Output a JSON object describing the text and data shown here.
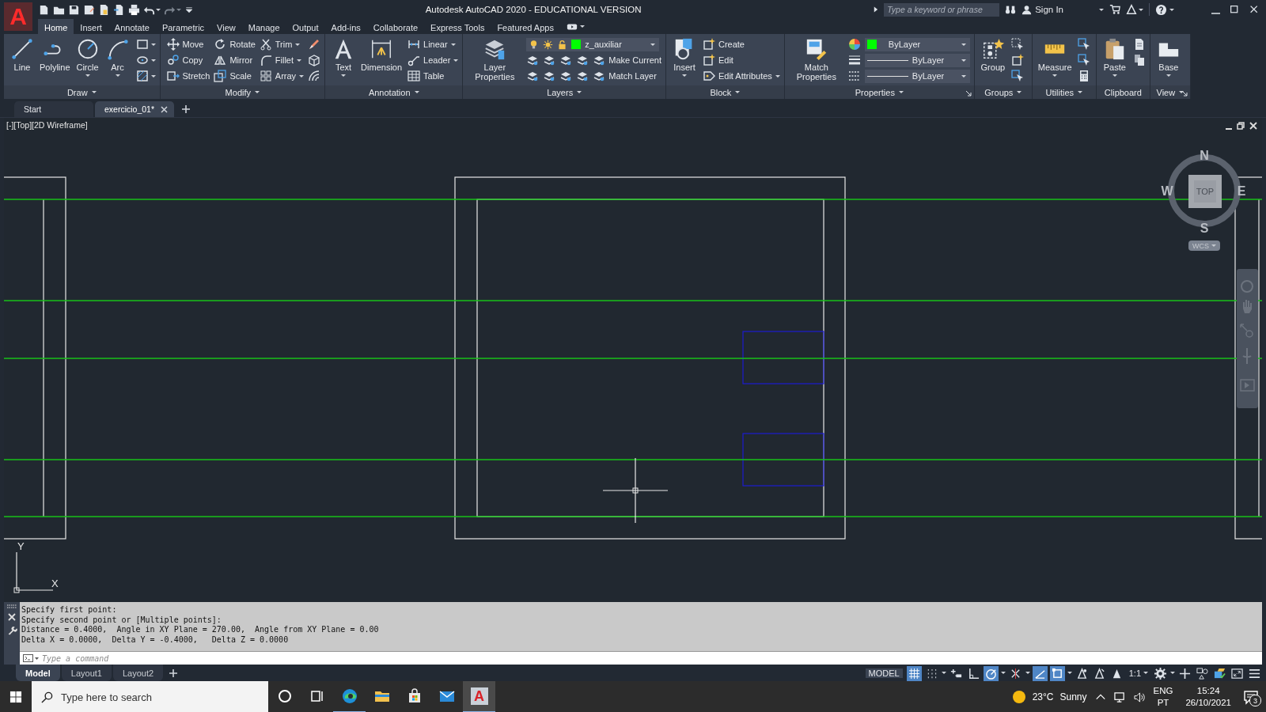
{
  "title_bar": {
    "logo": "A",
    "title": "Autodesk AutoCAD 2020 - EDUCATIONAL VERSION",
    "search": {
      "placeholder": "Type a keyword or phrase"
    },
    "sign_in": "Sign In"
  },
  "menu_tabs": [
    {
      "label": "Home",
      "selected": true
    },
    {
      "label": "Insert",
      "selected": false
    },
    {
      "label": "Annotate",
      "selected": false
    },
    {
      "label": "Parametric",
      "selected": false
    },
    {
      "label": "View",
      "selected": false
    },
    {
      "label": "Manage",
      "selected": false
    },
    {
      "label": "Output",
      "selected": false
    },
    {
      "label": "Add-ins",
      "selected": false
    },
    {
      "label": "Collaborate",
      "selected": false
    },
    {
      "label": "Express Tools",
      "selected": false
    },
    {
      "label": "Featured Apps",
      "selected": false
    }
  ],
  "ribbon": {
    "panels": [
      {
        "title": "Draw",
        "menu": true,
        "launcher": false,
        "large": [
          {
            "label": "Line",
            "kind": "plain"
          },
          {
            "label": "Polyline",
            "kind": "plain"
          },
          {
            "label": "Circle",
            "kind": "menu"
          },
          {
            "label": "Arc",
            "kind": "menu"
          }
        ],
        "items": [
          {
            "kind": "icon_menu"
          },
          {
            "kind": "icon_menu"
          },
          {
            "kind": "icon_menu"
          }
        ]
      },
      {
        "title": "Modify",
        "menu": true,
        "launcher": false,
        "items": [
          {
            "kind": "small",
            "label": "Move"
          },
          {
            "kind": "small",
            "label": "Rotate"
          },
          {
            "kind": "small_menu",
            "label": "Trim"
          },
          {
            "kind": "icon"
          },
          {
            "kind": "small",
            "label": "Copy"
          },
          {
            "kind": "small",
            "label": "Mirror"
          },
          {
            "kind": "small_menu",
            "label": "Fillet"
          },
          {
            "kind": "icon"
          },
          {
            "kind": "small",
            "label": "Stretch"
          },
          {
            "kind": "small",
            "label": "Scale"
          },
          {
            "kind": "small_menu",
            "label": "Array"
          },
          {
            "kind": "icon"
          }
        ]
      },
      {
        "title": "Annotation",
        "menu": true,
        "launcher": false,
        "large": [
          {
            "label": "Text",
            "kind": "menu"
          },
          {
            "label": "Dimension",
            "kind": "plain"
          }
        ],
        "items": [
          {
            "kind": "small_menu",
            "label": "Linear"
          },
          {
            "kind": "small_menu",
            "label": "Leader"
          },
          {
            "kind": "small",
            "label": "Table"
          }
        ]
      },
      {
        "title": "Layers",
        "menu": true,
        "launcher": false,
        "large": [
          {
            "label": "Layer Properties",
            "kind": "plain"
          }
        ],
        "items": [
          {
            "kind": "layer_select",
            "value": "z_auxiliar",
            "color": "#00ff00"
          },
          {
            "kind": "icon"
          },
          {
            "kind": "icon"
          },
          {
            "kind": "icon"
          },
          {
            "kind": "icon"
          },
          {
            "kind": "small",
            "label": "Make Current"
          },
          {
            "kind": "icon"
          },
          {
            "kind": "icon"
          },
          {
            "kind": "icon"
          },
          {
            "kind": "icon"
          },
          {
            "kind": "small",
            "label": "Match Layer"
          }
        ]
      },
      {
        "title": "Block",
        "menu": true,
        "launcher": false,
        "large": [
          {
            "label": "Insert",
            "kind": "menu"
          }
        ],
        "items": [
          {
            "kind": "small",
            "label": "Create"
          },
          {
            "kind": "small",
            "label": "Edit"
          },
          {
            "kind": "small_menu",
            "label": "Edit Attributes"
          }
        ]
      },
      {
        "title": "Properties",
        "menu": true,
        "launcher": true,
        "large": [
          {
            "label": "Match Properties",
            "kind": "plain"
          }
        ],
        "items": [
          {
            "kind": "icon"
          },
          {
            "kind": "color_select",
            "value": "ByLayer",
            "color": "#00ff00"
          },
          {
            "kind": "icon"
          },
          {
            "kind": "line_select",
            "value": "ByLayer"
          },
          {
            "kind": "icon"
          },
          {
            "kind": "line_select",
            "value": "ByLayer"
          }
        ]
      },
      {
        "title": "Groups",
        "menu": true,
        "launcher": false,
        "large": [
          {
            "label": "Group",
            "kind": "plain"
          }
        ],
        "items": [
          {
            "kind": "icon"
          },
          {
            "kind": "icon"
          },
          {
            "kind": "icon"
          }
        ]
      },
      {
        "title": "Utilities",
        "menu": true,
        "launcher": false,
        "large": [
          {
            "label": "Measure",
            "kind": "menu"
          }
        ],
        "items": [
          {
            "kind": "icon"
          },
          {
            "kind": "icon"
          },
          {
            "kind": "icon"
          }
        ]
      },
      {
        "title": "Clipboard",
        "menu": false,
        "launcher": false,
        "large": [
          {
            "label": "Paste",
            "kind": "menu"
          }
        ],
        "items": [
          {
            "kind": "icon"
          },
          {
            "kind": "icon"
          }
        ]
      },
      {
        "title": "View",
        "menu": true,
        "launcher": true,
        "large": [
          {
            "label": "Base",
            "kind": "menu"
          }
        ]
      }
    ]
  },
  "file_tabs": [
    {
      "label": "Start",
      "selected": false,
      "closable": false
    },
    {
      "label": "exercicio_01*",
      "selected": true,
      "closable": true
    }
  ],
  "viewport": {
    "label": "[-][Top][2D Wireframe]",
    "viewcube": {
      "north": "N",
      "south": "S",
      "west": "W",
      "east": "E",
      "face": "TOP"
    },
    "ucs_menu": "WCS",
    "ucs_icon": {
      "x": "X",
      "y": "Y"
    }
  },
  "command": {
    "history": [
      "Specify first point:",
      "Specify second point or [Multiple points]:",
      "Distance = 0.4000,  Angle in XY Plane = 270.00,  Angle from XY Plane = 0.00",
      "Delta X = 0.0000,  Delta Y = -0.4000,   Delta Z = 0.0000"
    ],
    "placeholder": "Type a command"
  },
  "layout_tabs": [
    {
      "label": "Model",
      "selected": true
    },
    {
      "label": "Layout1",
      "selected": false
    },
    {
      "label": "Layout2",
      "selected": false
    }
  ],
  "status_bar": {
    "model": "MODEL",
    "toggles": [
      {
        "on": true
      },
      {
        "on": false
      },
      {
        "on": false
      },
      {
        "on": false
      },
      {
        "on": true
      },
      {
        "on": false
      },
      {
        "on": true
      },
      {
        "on": true
      },
      {
        "on": false
      },
      {
        "on": false
      },
      {
        "on": false
      }
    ],
    "scale": "1:1"
  },
  "taskbar": {
    "search": {
      "placeholder": "Type here to search"
    },
    "apps": [
      {
        "kind": "cortana",
        "running": false,
        "active": false
      },
      {
        "kind": "taskview",
        "running": false,
        "active": false
      },
      {
        "kind": "browser",
        "running": true,
        "active": false
      },
      {
        "kind": "folder",
        "running": false,
        "active": false
      },
      {
        "kind": "store",
        "running": false,
        "active": false
      },
      {
        "kind": "mail",
        "running": false,
        "active": false
      },
      {
        "kind": "cad",
        "logo": "A",
        "running": true,
        "active": true
      }
    ],
    "weather": {
      "temperature": "23°C",
      "condition": "Sunny"
    },
    "language": "ENG",
    "keyboard": "PT",
    "time": "15:24",
    "date": "26/10/2021",
    "notifications": "3"
  }
}
